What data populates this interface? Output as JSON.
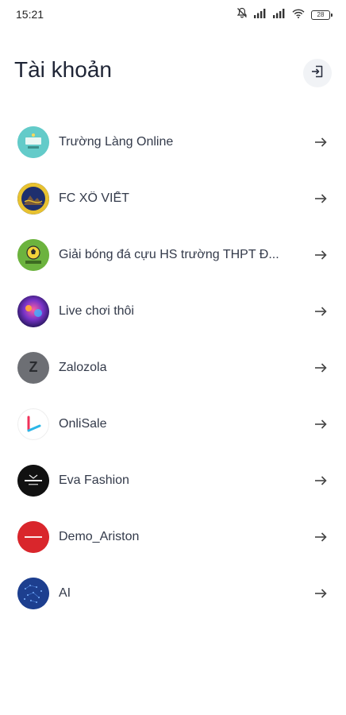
{
  "status_bar": {
    "time": "15:21",
    "battery_level": "28"
  },
  "header": {
    "title": "Tài khoản",
    "logout_icon": "logout-icon"
  },
  "accounts": [
    {
      "name": "Trường Làng Online",
      "avatar_icon": "school-logo",
      "avatar_color": "#5ec8c8"
    },
    {
      "name": "FC XÔ VIẾT",
      "avatar_icon": "football-club-crest",
      "avatar_color": "#1e2f6e"
    },
    {
      "name": "Giải bóng đá cựu HS trường THPT Đ...",
      "avatar_icon": "football-tournament-logo",
      "avatar_color": "#6cb33e"
    },
    {
      "name": "Live chơi thôi",
      "avatar_icon": "game-avatar",
      "avatar_color": "#5a2a8c"
    },
    {
      "name": "Zalozola",
      "avatar_icon": "letter-avatar",
      "avatar_letter": "Z",
      "avatar_color": "#6d6f74"
    },
    {
      "name": "OnliSale",
      "avatar_icon": "onlisale-logo",
      "avatar_color": "#ffffff"
    },
    {
      "name": "Eva Fashion",
      "avatar_icon": "fashion-store-logo",
      "avatar_color": "#111111"
    },
    {
      "name": "Demo_Ariston",
      "avatar_icon": "ariston-logo",
      "avatar_color": "#d9262c"
    },
    {
      "name": "AI",
      "avatar_icon": "ai-avatar",
      "avatar_color": "#1d3f8f"
    }
  ],
  "item_arrow_icon": "arrow-right-icon"
}
